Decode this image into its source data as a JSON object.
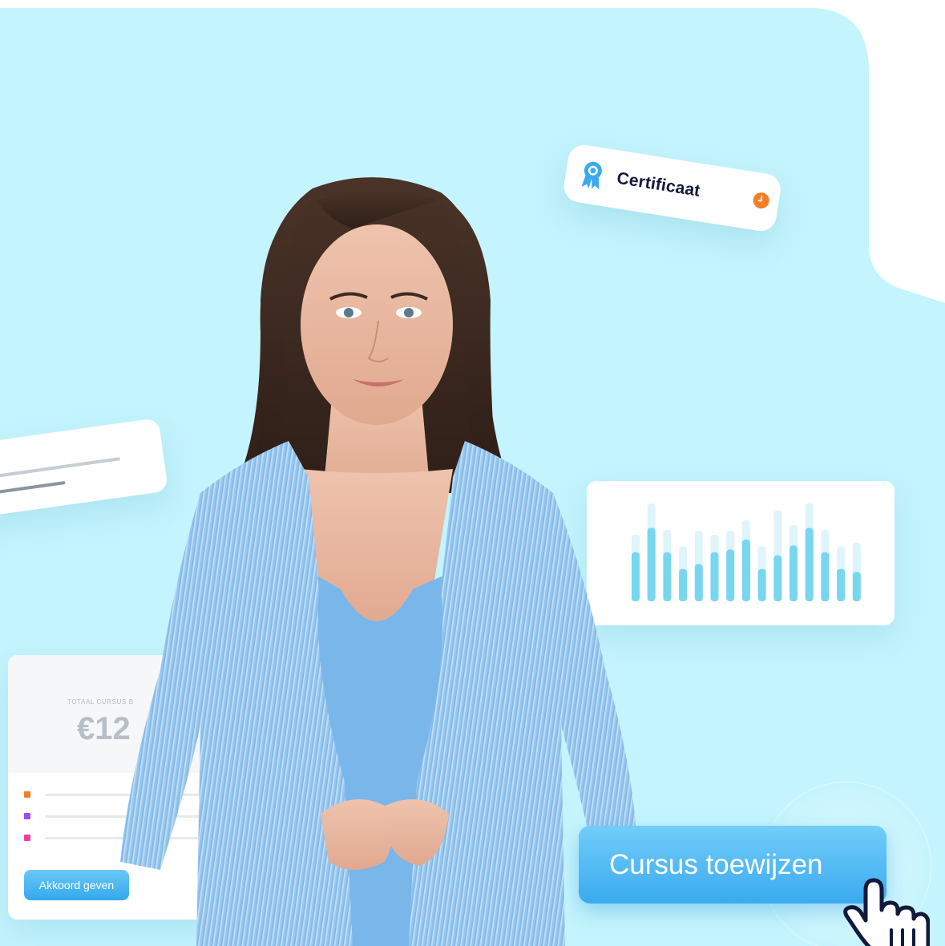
{
  "certificate_card": {
    "label": "Certificaat",
    "icon": "award-ribbon-icon",
    "status_icon": "clock-icon"
  },
  "price_card": {
    "caption": "TOTAAL CURSUS B",
    "amount": "€12",
    "legend_colors": [
      "#f47e26",
      "#9b4df0",
      "#f23aa5"
    ],
    "button_label": "Akkoord geven"
  },
  "cta": {
    "label": "Cursus toewijzen",
    "cursor_icon": "pointer-hand-icon"
  },
  "chart_data": {
    "type": "bar",
    "series": [
      {
        "values": [
          0.5,
          0.75,
          0.5,
          0.33,
          0.38,
          0.5,
          0.53,
          0.63,
          0.33,
          0.47,
          0.57,
          0.75,
          0.5,
          0.33,
          0.3
        ]
      },
      {
        "values": [
          0.68,
          1.0,
          0.73,
          0.56,
          0.72,
          0.68,
          0.72,
          0.83,
          0.56,
          0.93,
          0.78,
          1.0,
          0.73,
          0.56,
          0.6
        ]
      }
    ],
    "colors": [
      "#79d6ef",
      "#dff4fb"
    ]
  },
  "colors": {
    "background": "#c4f4fd",
    "accent": "#3aaaf0",
    "text_dark": "#111a3d"
  }
}
